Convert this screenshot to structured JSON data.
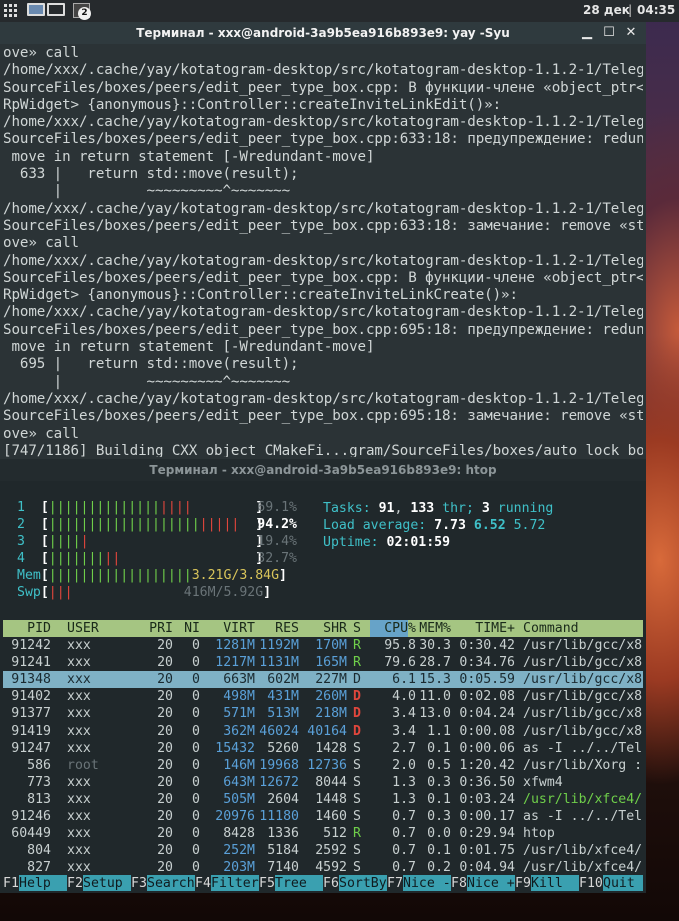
{
  "panel": {
    "date": "28 дек",
    "time": "04:35",
    "sep": "|",
    "task_badge": "2"
  },
  "terminal1": {
    "title": "Терминал - xxx@android-3a9b5ea916b893e9: yay -Syu",
    "lines": [
      "ove» call",
      "/home/xxx/.cache/yay/kotatogram-desktop/src/kotatogram-desktop-1.1.2-1/Telegram/",
      "SourceFiles/boxes/peers/edit_peer_type_box.cpp: В функции-члене «object_ptr<Ui::",
      "RpWidget> {anonymous}::Controller::createInviteLinkEdit()»:",
      "/home/xxx/.cache/yay/kotatogram-desktop/src/kotatogram-desktop-1.1.2-1/Telegram/",
      "SourceFiles/boxes/peers/edit_peer_type_box.cpp:633:18: предупреждение: redundant",
      " move in return statement [-Wredundant-move]",
      "  633 |   return std::move(result);",
      "      |          ~~~~~~~~~^~~~~~~~",
      "/home/xxx/.cache/yay/kotatogram-desktop/src/kotatogram-desktop-1.1.2-1/Telegram/",
      "SourceFiles/boxes/peers/edit_peer_type_box.cpp:633:18: замечание: remove «std::m",
      "ove» call",
      "/home/xxx/.cache/yay/kotatogram-desktop/src/kotatogram-desktop-1.1.2-1/Telegram/",
      "SourceFiles/boxes/peers/edit_peer_type_box.cpp: В функции-члене «object_ptr<Ui::",
      "RpWidget> {anonymous}::Controller::createInviteLinkCreate()»:",
      "/home/xxx/.cache/yay/kotatogram-desktop/src/kotatogram-desktop-1.1.2-1/Telegram/",
      "SourceFiles/boxes/peers/edit_peer_type_box.cpp:695:18: предупреждение: redundant",
      " move in return statement [-Wredundant-move]",
      "  695 |   return std::move(result);",
      "      |          ~~~~~~~~~^~~~~~~~",
      "/home/xxx/.cache/yay/kotatogram-desktop/src/kotatogram-desktop-1.1.2-1/Telegram/",
      "SourceFiles/boxes/peers/edit_peer_type_box.cpp:695:18: замечание: remove «std::m",
      "ove» call",
      "[747/1186] Building CXX object CMakeFi...gram/SourceFiles/boxes/auto_lock_box.o"
    ]
  },
  "terminal2": {
    "title": "Терминал - xxx@android-3a9b5ea916b893e9: htop",
    "cpus": [
      {
        "id": "1",
        "percent": "69.1%",
        "usage": 0.691
      },
      {
        "id": "2",
        "percent": "94.2%",
        "usage": 0.942
      },
      {
        "id": "3",
        "percent": "19.4%",
        "usage": 0.194
      },
      {
        "id": "4",
        "percent": "32.7%",
        "usage": 0.327
      }
    ],
    "mem": {
      "label": "Mem",
      "value": "3.21G/3.84G",
      "usage": 0.836
    },
    "swp": {
      "label": "Swp",
      "value": "416M/5.92G",
      "usage": 0.07
    },
    "tasks": {
      "label": "Tasks:",
      "count": "91",
      "thr": "133",
      "thr_label": "thr;",
      "running": "3",
      "running_label": "running"
    },
    "load": {
      "label": "Load average:",
      "l1": "7.73",
      "l5": "6.52",
      "l15": "5.72"
    },
    "uptime": {
      "label": "Uptime:",
      "value": "02:01:59"
    },
    "columns": [
      "PID",
      "USER",
      "PRI",
      "NI",
      "VIRT",
      "RES",
      "SHR",
      "S",
      "CPU%",
      "MEM%",
      "TIME+",
      "Command"
    ],
    "processes": [
      [
        "91242",
        "xxx",
        "20",
        "0",
        "1281M",
        "1192M",
        "170M",
        "R",
        "95.8",
        "30.3",
        "0:30.42",
        "/usr/lib/gcc/x8"
      ],
      [
        "91241",
        "xxx",
        "20",
        "0",
        "1217M",
        "1131M",
        "165M",
        "R",
        "79.6",
        "28.7",
        "0:34.76",
        "/usr/lib/gcc/x8"
      ],
      [
        "91348",
        "xxx",
        "20",
        "0",
        "663M",
        "602M",
        "227M",
        "D",
        "6.1",
        "15.3",
        "0:05.59",
        "/usr/lib/gcc/x8"
      ],
      [
        "91402",
        "xxx",
        "20",
        "0",
        "498M",
        "431M",
        "260M",
        "D",
        "4.0",
        "11.0",
        "0:02.08",
        "/usr/lib/gcc/x8"
      ],
      [
        "91377",
        "xxx",
        "20",
        "0",
        "571M",
        "513M",
        "218M",
        "D",
        "3.4",
        "13.0",
        "0:04.24",
        "/usr/lib/gcc/x8"
      ],
      [
        "91419",
        "xxx",
        "20",
        "0",
        "362M",
        "46024",
        "40164",
        "D",
        "3.4",
        "1.1",
        "0:00.08",
        "/usr/lib/gcc/x8"
      ],
      [
        "91247",
        "xxx",
        "20",
        "0",
        "15432",
        "5260",
        "1428",
        "S",
        "2.7",
        "0.1",
        "0:00.06",
        "as -I ../../Tel"
      ],
      [
        "586",
        "root",
        "20",
        "0",
        "146M",
        "19968",
        "12736",
        "S",
        "2.0",
        "0.5",
        "1:20.42",
        "/usr/lib/Xorg :"
      ],
      [
        "773",
        "xxx",
        "20",
        "0",
        "643M",
        "12672",
        "8044",
        "S",
        "1.3",
        "0.3",
        "0:36.50",
        "xfwm4"
      ],
      [
        "813",
        "xxx",
        "20",
        "0",
        "505M",
        "2604",
        "1448",
        "S",
        "1.3",
        "0.1",
        "0:03.24",
        "/usr/lib/xfce4/"
      ],
      [
        "91246",
        "xxx",
        "20",
        "0",
        "20976",
        "11180",
        "1460",
        "S",
        "0.7",
        "0.3",
        "0:00.17",
        "as -I ../../Tel"
      ],
      [
        "60449",
        "xxx",
        "20",
        "0",
        "8428",
        "1336",
        "512",
        "R",
        "0.7",
        "0.0",
        "0:29.94",
        "htop"
      ],
      [
        "804",
        "xxx",
        "20",
        "0",
        "252M",
        "5184",
        "2592",
        "S",
        "0.7",
        "0.1",
        "0:01.75",
        "/usr/lib/xfce4/"
      ],
      [
        "827",
        "xxx",
        "20",
        "0",
        "203M",
        "7140",
        "4592",
        "S",
        "0.7",
        "0.2",
        "0:04.94",
        "/usr/lib/xfce4/"
      ]
    ],
    "fkeys": [
      {
        "key": "F1",
        "label": "Help"
      },
      {
        "key": "F2",
        "label": "Setup"
      },
      {
        "key": "F3",
        "label": "Search"
      },
      {
        "key": "F4",
        "label": "Filter"
      },
      {
        "key": "F5",
        "label": "Tree"
      },
      {
        "key": "F6",
        "label": "SortBy"
      },
      {
        "key": "F7",
        "label": "Nice -"
      },
      {
        "key": "F8",
        "label": "Nice +"
      },
      {
        "key": "F9",
        "label": "Kill"
      },
      {
        "key": "F10",
        "label": "Quit"
      }
    ]
  },
  "colors": {
    "header_bg": "#a5c582",
    "selected_row": "#7fb1c5",
    "fkey_label_bg": "#3aa0b0",
    "bar_green": "#6fcf4a",
    "bar_red": "#e0463c"
  }
}
